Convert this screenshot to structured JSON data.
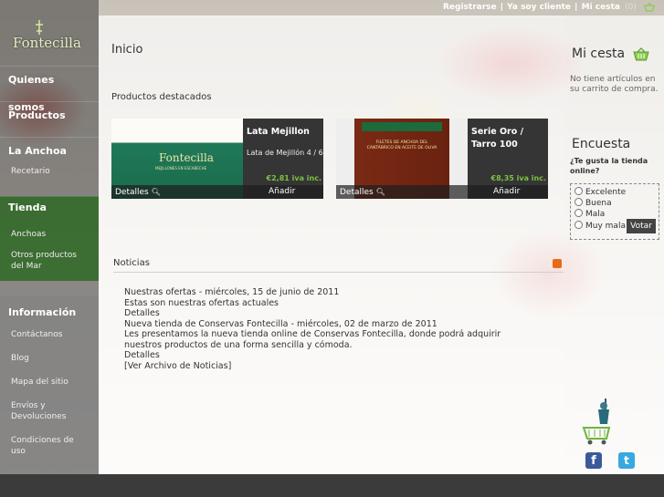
{
  "topbar": {
    "register": "Registrarse",
    "client": "Ya soy cliente",
    "basket": "Mi cesta",
    "basket_count": "(0)"
  },
  "logo": {
    "text": "Fontecilla"
  },
  "sidebar": {
    "quienes": "Quienes somos",
    "productos": "Productos",
    "anchoa": "La Anchoa",
    "recetario": "Recetario",
    "tienda": "Tienda",
    "anchoas": "Anchoas",
    "otros": "Otros productos del Mar",
    "informacion": "Información",
    "contactanos": "Contáctanos",
    "blog": "Blog",
    "mapa": "Mapa del sitio",
    "envios": "Envíos y Devoluciones",
    "condiciones": "Condiciones de uso"
  },
  "main": {
    "title": "Inicio",
    "featured": "Productos destacados",
    "products": [
      {
        "name": "Lata Mejillon",
        "desc": "Lata de Mejillón 4 / 6",
        "price": "€2,81 iva inc.",
        "details": "Detalles",
        "add": "Añadir",
        "img_label": "Fontecilla",
        "img_sub": "MEJILLONES EN ESCABECHE"
      },
      {
        "name": "Serie Oro / Tarro 100",
        "desc": "",
        "price": "€8,35 iva inc.",
        "details": "Detalles",
        "add": "Añadir",
        "img_label": "FILETES DE ANCHOA DEL CANTÁBRICO EN ACEITE DE OLIVA",
        "img_sub": ""
      }
    ],
    "news_title": "Noticias",
    "news": [
      "Nuestras ofertas - miércoles, 15 de junio de 2011",
      "Estas son nuestras ofertas actuales",
      "Detalles",
      "Nueva tienda de Conservas Fontecilla - miércoles, 02 de marzo de 2011",
      "Les presentamos la nueva tienda online de Conservas Fontecilla, donde podrá adquirir nuestros productos de una forma sencilla y cómoda.",
      "Detalles",
      "[Ver Archivo de Noticias]"
    ]
  },
  "right": {
    "cesta_title": "Mi cesta",
    "cesta_empty": "No tiene artículos en su carrito de compra.",
    "poll_title": "Encuesta",
    "poll_question": "¿Te gusta la tienda online?",
    "options": [
      "Excelente",
      "Buena",
      "Mala",
      "Muy mala"
    ],
    "vote": "Votar",
    "facebook": "f",
    "twitter": "t"
  },
  "colors": {
    "accent_green": "#7cc142",
    "tienda_green": "#1e6414",
    "basket_green": "#6fb43f"
  }
}
